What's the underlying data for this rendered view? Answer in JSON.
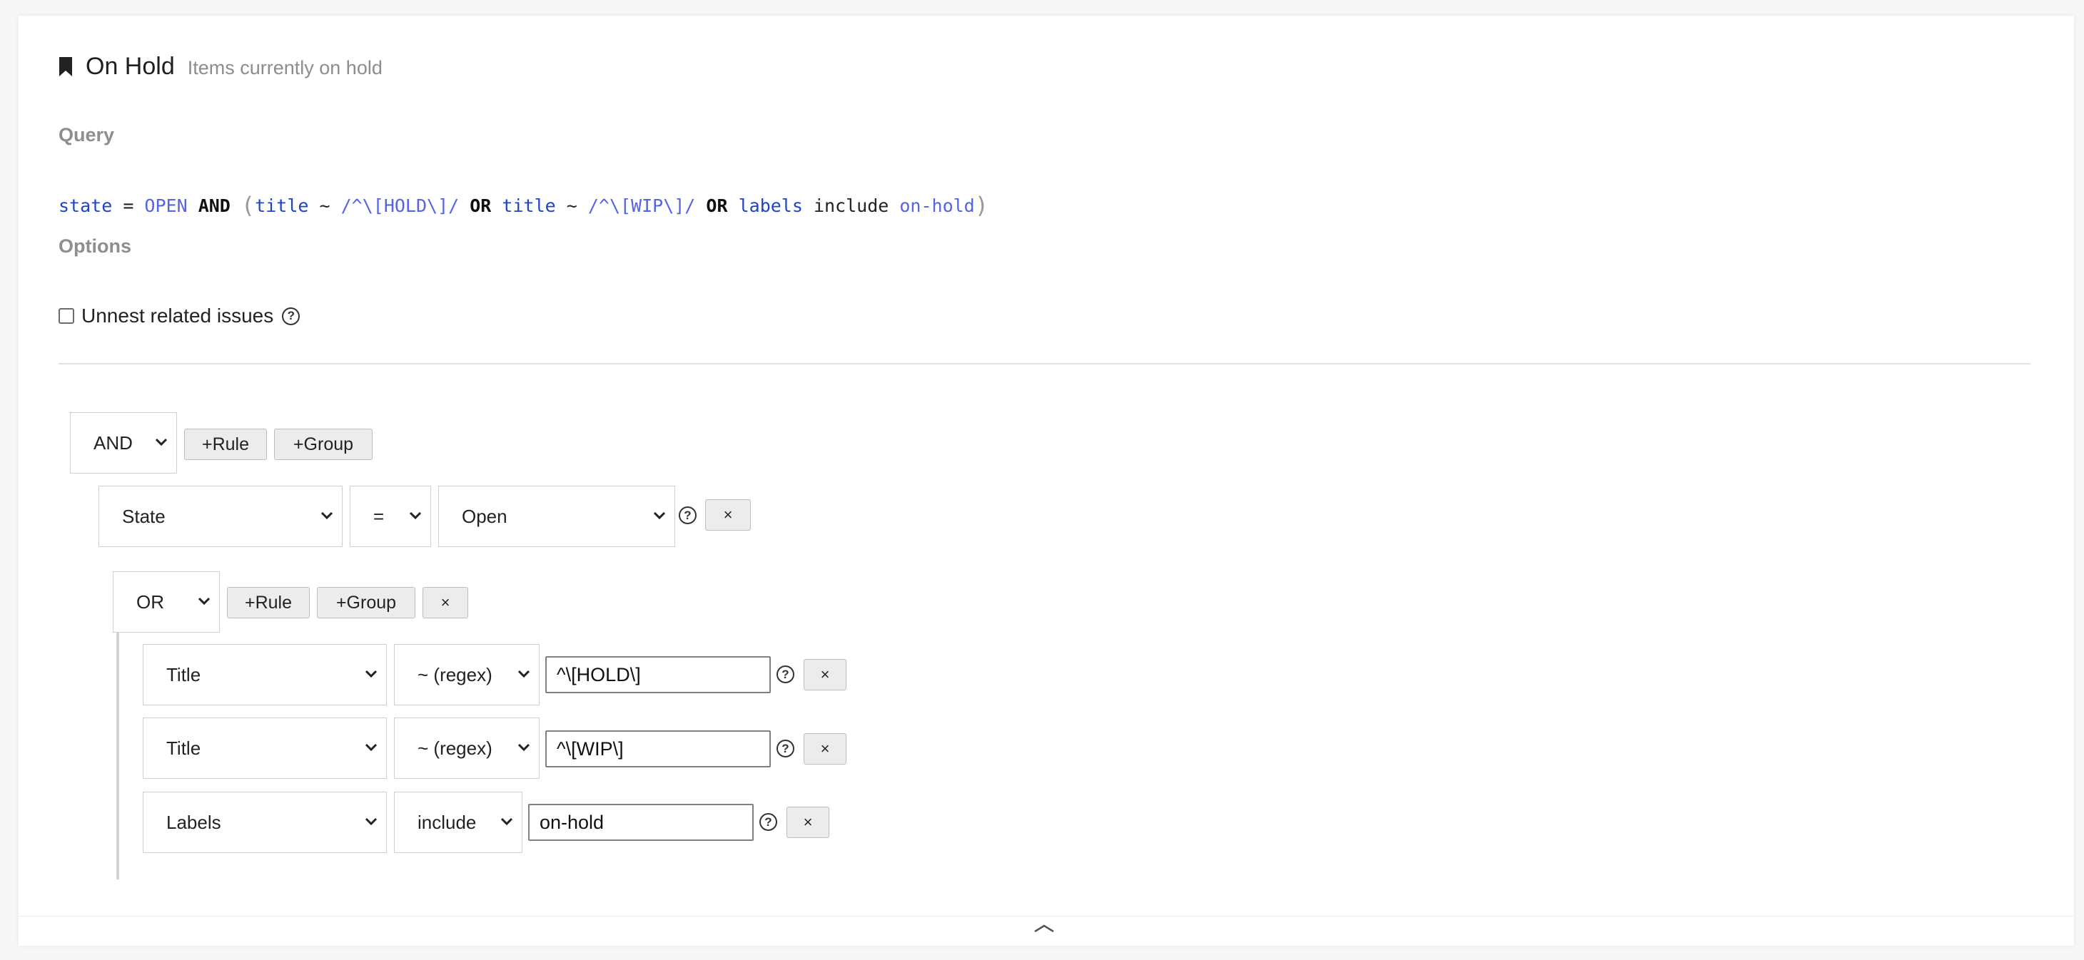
{
  "header": {
    "title": "On Hold",
    "subtitle": "Items currently on hold",
    "icon": "bookmark-icon"
  },
  "query_section": {
    "label": "Query",
    "tokens": [
      {
        "text": "state",
        "kind": "field"
      },
      {
        "text": " = ",
        "kind": "op"
      },
      {
        "text": "OPEN",
        "kind": "value"
      },
      {
        "text": " ",
        "kind": "op"
      },
      {
        "text": "AND",
        "kind": "keyword"
      },
      {
        "text": " ",
        "kind": "op"
      },
      {
        "text": "(",
        "kind": "paren"
      },
      {
        "text": "title",
        "kind": "field"
      },
      {
        "text": " ~ ",
        "kind": "op"
      },
      {
        "text": "/^\\[HOLD\\]/",
        "kind": "value"
      },
      {
        "text": " ",
        "kind": "op"
      },
      {
        "text": "OR",
        "kind": "keyword"
      },
      {
        "text": " ",
        "kind": "op"
      },
      {
        "text": "title",
        "kind": "field"
      },
      {
        "text": " ~ ",
        "kind": "op"
      },
      {
        "text": "/^\\[WIP\\]/",
        "kind": "value"
      },
      {
        "text": " ",
        "kind": "op"
      },
      {
        "text": "OR",
        "kind": "keyword"
      },
      {
        "text": " ",
        "kind": "op"
      },
      {
        "text": "labels",
        "kind": "field"
      },
      {
        "text": " include ",
        "kind": "op"
      },
      {
        "text": "on-hold",
        "kind": "value"
      },
      {
        "text": ")",
        "kind": "paren"
      }
    ]
  },
  "options_section": {
    "label": "Options",
    "unnest_label": "Unnest related issues",
    "unnest_checked": false,
    "help_glyph": "?"
  },
  "builder": {
    "root": {
      "combinator": "AND",
      "add_rule_label": "+Rule",
      "add_group_label": "+Group"
    },
    "state_rule": {
      "field": "State",
      "operator": "=",
      "value": "Open",
      "remove_label": "×"
    },
    "subgroup": {
      "combinator": "OR",
      "add_rule_label": "+Rule",
      "add_group_label": "+Group",
      "remove_label": "×"
    },
    "rules": [
      {
        "field": "Title",
        "operator": "~ (regex)",
        "value": "^\\[HOLD\\]",
        "remove_label": "×"
      },
      {
        "field": "Title",
        "operator": "~ (regex)",
        "value": "^\\[WIP\\]",
        "remove_label": "×"
      },
      {
        "field": "Labels",
        "operator": "include",
        "value": "on-hold",
        "remove_label": "×"
      }
    ]
  },
  "colors": {
    "field": "#1f44c6",
    "value": "#5563e6",
    "muted": "#8e8e8e"
  }
}
